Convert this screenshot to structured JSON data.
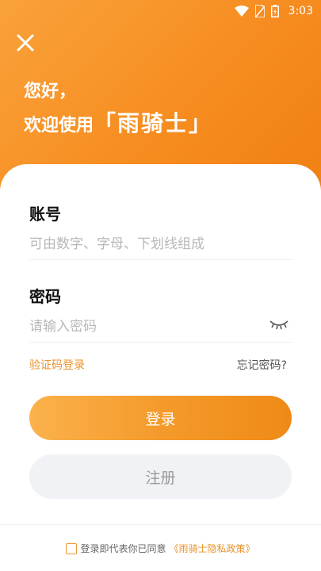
{
  "status_bar": {
    "time": "3:03",
    "icons": [
      "wifi-icon",
      "no-sim-icon",
      "battery-icon"
    ]
  },
  "header": {
    "close_icon": "close-icon",
    "greeting_line1": "您好，",
    "greeting_prefix": "欢迎使用",
    "brand": "「雨骑士」"
  },
  "form": {
    "account_label": "账号",
    "account_placeholder": "可由数字、字母、下划线组成",
    "password_label": "密码",
    "password_placeholder": "请输入密码",
    "eye_icon": "eye-closed-icon",
    "sms_login": "验证码登录",
    "forgot_password": "忘记密码?",
    "login_button": "登录",
    "register_button": "注册"
  },
  "footer": {
    "agree_text": "登录即代表你已同意",
    "policy_link": "《雨骑士隐私政策》"
  },
  "colors": {
    "accent": "#f68b1e",
    "link": "#e8932c",
    "register_bg": "#f1f2f6"
  }
}
